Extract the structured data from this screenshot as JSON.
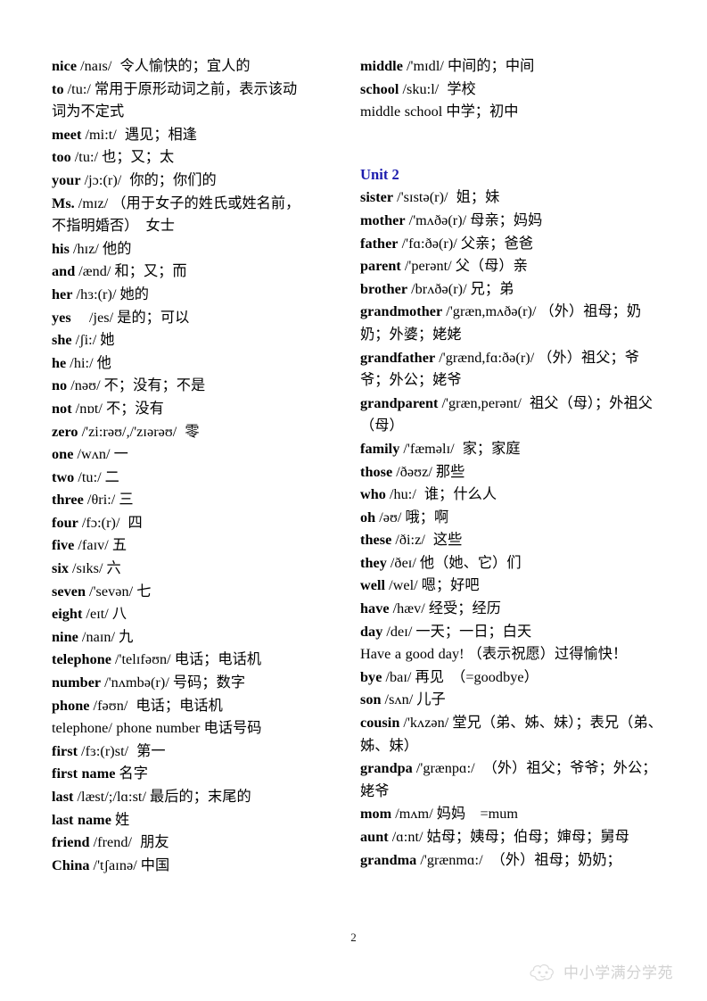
{
  "document": {
    "page_number": "2",
    "accent_color": "#1d1dae",
    "watermark": {
      "text": "中小学满分学苑",
      "logo_icon": "cloud-face-logo-icon"
    }
  },
  "columns": {
    "left": {
      "entries": [
        {
          "headword": "nice",
          "bold": true,
          "ipa": "/naɪs/",
          "gap": "wide",
          "definition": "令人愉快的；宜人的"
        },
        {
          "headword": "to",
          "bold": true,
          "ipa": "/tu:/",
          "gap": "thin",
          "definition": "常用于原形动词之前，表示该动词为不定式"
        },
        {
          "headword": "meet",
          "bold": true,
          "ipa": "/mi:t/",
          "gap": "wide",
          "definition": "遇见；相逢"
        },
        {
          "headword": "too",
          "bold": true,
          "ipa": "/tu:/",
          "gap": "thin",
          "definition": "也；又；太"
        },
        {
          "headword": "your",
          "bold": true,
          "ipa": "/jɔ:(r)/",
          "gap": "wide",
          "definition": "你的；你们的"
        },
        {
          "headword": "Ms.",
          "bold": true,
          "ipa": "/mɪz/",
          "gap": "thin",
          "definition": "（用于女子的姓氏或姓名前，不指明婚否）　女士"
        },
        {
          "headword": "his",
          "bold": true,
          "ipa": "/hɪz/",
          "gap": "thin",
          "definition": "他的"
        },
        {
          "headword": "and",
          "bold": true,
          "ipa": "/ænd/",
          "gap": "thin",
          "definition": "和；又；而"
        },
        {
          "headword": "her",
          "bold": true,
          "ipa": "/hɜ:(r)/",
          "gap": "thin",
          "definition": "她的"
        },
        {
          "headword": "yes",
          "bold": true,
          "ipa": "　/jes/",
          "gap": "thin",
          "definition": "是的；可以"
        },
        {
          "headword": "she",
          "bold": true,
          "ipa": "/ʃi:/",
          "gap": "thin",
          "definition": "她"
        },
        {
          "headword": "he",
          "bold": true,
          "ipa": "/hi:/",
          "gap": "thin",
          "definition": "他"
        },
        {
          "headword": "no",
          "bold": true,
          "ipa": "/nəʊ/",
          "gap": "thin",
          "definition": "不；没有；不是"
        },
        {
          "headword": "not",
          "bold": true,
          "ipa": "/nɒt/",
          "gap": "thin",
          "definition": "不；没有"
        },
        {
          "headword": "zero",
          "bold": true,
          "ipa": "/'zi:rəʊ/,/'zɪərəʊ/",
          "gap": "wide",
          "definition": "零"
        },
        {
          "headword": "one",
          "bold": true,
          "ipa": "/wʌn/",
          "gap": "thin",
          "definition": "一"
        },
        {
          "headword": "two",
          "bold": true,
          "ipa": "/tu:/",
          "gap": "thin",
          "definition": "二"
        },
        {
          "headword": "three",
          "bold": true,
          "ipa": "/θri:/",
          "gap": "thin",
          "definition": "三"
        },
        {
          "headword": "four",
          "bold": true,
          "ipa": "/fɔ:(r)/",
          "gap": "wide",
          "definition": "四"
        },
        {
          "headword": "five",
          "bold": true,
          "ipa": "/faɪv/",
          "gap": "thin",
          "definition": "五"
        },
        {
          "headword": "six",
          "bold": true,
          "ipa": "/sɪks/",
          "gap": "thin",
          "definition": "六"
        },
        {
          "headword": "seven",
          "bold": true,
          "ipa": "/'sevən/",
          "gap": "thin",
          "definition": "七"
        },
        {
          "headword": "eight",
          "bold": true,
          "ipa": "/eɪt/",
          "gap": "thin",
          "definition": "八"
        },
        {
          "headword": "nine",
          "bold": true,
          "ipa": "/naɪn/",
          "gap": "thin",
          "definition": "九"
        },
        {
          "headword": "telephone",
          "bold": true,
          "ipa": "/'telɪfəʊn/",
          "gap": "thin",
          "definition": "电话；电话机"
        },
        {
          "headword": "number",
          "bold": true,
          "ipa": "/'nʌmbə(r)/",
          "gap": "thin",
          "definition": "号码；数字"
        },
        {
          "headword": "phone",
          "bold": true,
          "ipa": "/fəʊn/",
          "gap": "wide",
          "definition": "电话；电话机"
        },
        {
          "headword": "telephone/ phone number",
          "bold": false,
          "ipa": "",
          "gap": "thin",
          "definition": "电话号码"
        },
        {
          "headword": "first",
          "bold": true,
          "ipa": "/fɜ:(r)st/",
          "gap": "wide",
          "definition": "第一"
        },
        {
          "headword": "first name",
          "bold": true,
          "ipa": "",
          "gap": "thin",
          "definition": "名字"
        },
        {
          "headword": "last",
          "bold": true,
          "ipa": "/læst/;/lɑ:st/",
          "gap": "thin",
          "definition": "最后的；末尾的"
        },
        {
          "headword": "last name",
          "bold": true,
          "ipa": "",
          "gap": "thin",
          "definition": "姓"
        },
        {
          "headword": "friend",
          "bold": true,
          "ipa": "/frend/",
          "gap": "wide",
          "definition": "朋友"
        },
        {
          "headword": "China",
          "bold": true,
          "ipa": "/'tʃaɪnə/",
          "gap": "thin",
          "definition": "中国"
        }
      ]
    },
    "right": {
      "entries_before_unit": [
        {
          "headword": "middle",
          "bold": true,
          "ipa": "/'mɪdl/",
          "gap": "thin",
          "definition": "中间的；中间"
        },
        {
          "headword": "school",
          "bold": true,
          "ipa": "/sku:l/",
          "gap": "wide",
          "definition": "学校"
        },
        {
          "headword": "middle school",
          "bold": false,
          "ipa": "",
          "gap": "thin",
          "definition": "中学；初中"
        }
      ],
      "unit_heading": "Unit 2",
      "entries_after_unit": [
        {
          "headword": "sister",
          "bold": true,
          "ipa": "/'sɪstə(r)/",
          "gap": "wide",
          "definition": "姐；妹"
        },
        {
          "headword": "mother",
          "bold": true,
          "ipa": "/'mʌðə(r)/",
          "gap": "thin",
          "definition": "母亲；妈妈"
        },
        {
          "headword": "father",
          "bold": true,
          "ipa": "/'fɑ:ðə(r)/",
          "gap": "thin",
          "definition": "父亲；爸爸"
        },
        {
          "headword": "parent",
          "bold": true,
          "ipa": "/'perənt/",
          "gap": "thin",
          "definition": "父（母）亲"
        },
        {
          "headword": "brother",
          "bold": true,
          "ipa": "/brʌðə(r)/",
          "gap": "thin",
          "definition": "兄；弟"
        },
        {
          "headword": "grandmother",
          "bold": true,
          "ipa": "/'græn,mʌðə(r)/",
          "gap": "thin",
          "definition": "（外）祖母；奶奶；外婆；姥姥"
        },
        {
          "headword": "grandfather",
          "bold": true,
          "ipa": "/'grænd,fɑ:ðə(r)/",
          "gap": "thin",
          "definition": "（外）祖父；爷爷；外公；姥爷"
        },
        {
          "headword": "grandparent",
          "bold": true,
          "ipa": "/'græn,perənt/",
          "gap": "wide",
          "definition": "祖父（母）；外祖父（母）"
        },
        {
          "headword": "family",
          "bold": true,
          "ipa": "/'fæməlɪ/",
          "gap": "wide",
          "definition": "家；家庭"
        },
        {
          "headword": "those",
          "bold": true,
          "ipa": "/ðəʊz/",
          "gap": "thin",
          "definition": "那些"
        },
        {
          "headword": "who",
          "bold": true,
          "ipa": "/hu:/",
          "gap": "wide",
          "definition": "谁；什么人"
        },
        {
          "headword": "oh",
          "bold": true,
          "ipa": "/əʊ/",
          "gap": "thin",
          "definition": "哦；啊"
        },
        {
          "headword": "these",
          "bold": true,
          "ipa": "/ði:z/",
          "gap": "wide",
          "definition": "这些"
        },
        {
          "headword": "they",
          "bold": true,
          "ipa": "/ðeɪ/",
          "gap": "thin",
          "definition": "他（她、它）们"
        },
        {
          "headword": "well",
          "bold": true,
          "ipa": "/wel/",
          "gap": "thin",
          "definition": "嗯；好吧"
        },
        {
          "headword": "have",
          "bold": true,
          "ipa": "/hæv/",
          "gap": "thin",
          "definition": "经受；经历"
        },
        {
          "headword": "day",
          "bold": true,
          "ipa": "/deɪ/",
          "gap": "thin",
          "definition": "一天；一日；白天"
        },
        {
          "headword": "Have a good day!",
          "bold": false,
          "ipa": "",
          "gap": "thin",
          "definition": "（表示祝愿）过得愉快！"
        },
        {
          "headword": "bye",
          "bold": true,
          "ipa": "/baɪ/",
          "gap": "thin",
          "definition": "再见　（=goodbye）"
        },
        {
          "headword": "son",
          "bold": true,
          "ipa": "/sʌn/",
          "gap": "thin",
          "definition": "儿子"
        },
        {
          "headword": "cousin",
          "bold": true,
          "ipa": "/'kʌzən/",
          "gap": "thin",
          "definition": "堂兄（弟、姊、妹）；表兄（弟、姊、妹）"
        },
        {
          "headword": "grandpa",
          "bold": true,
          "ipa": "/'grænpɑ:/",
          "gap": "wide",
          "definition": "（外）祖父；爷爷；外公；姥爷"
        },
        {
          "headword": "mom",
          "bold": true,
          "ipa": "/mʌm/",
          "gap": "thin",
          "definition": "妈妈　=mum"
        },
        {
          "headword": "aunt",
          "bold": true,
          "ipa": "/ɑ:nt/",
          "gap": "thin",
          "definition": "姑母；姨母；伯母；婶母；舅母"
        },
        {
          "headword": "grandma",
          "bold": true,
          "ipa": "/'grænmɑ:/",
          "gap": "wide",
          "definition": "（外）祖母；奶奶；"
        }
      ]
    }
  }
}
